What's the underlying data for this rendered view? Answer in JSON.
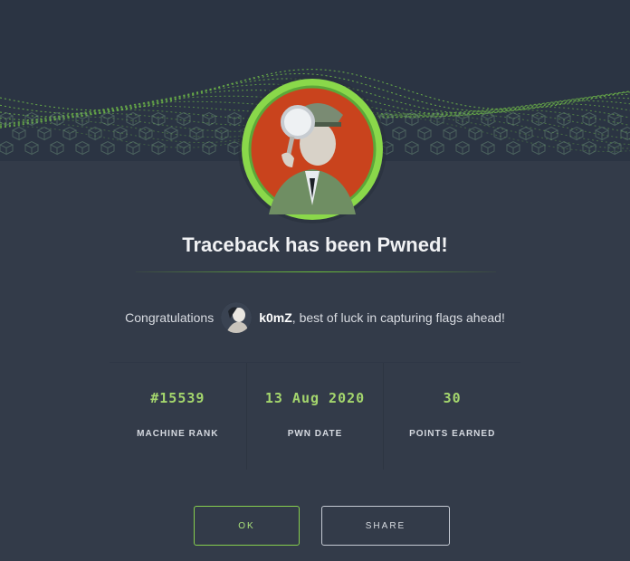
{
  "modal": {
    "title": "Traceback has been Pwned!",
    "congrats_prefix": "Congratulations",
    "username": "k0mZ",
    "congrats_suffix": ", best of luck in capturing flags ahead!"
  },
  "stats": [
    {
      "value": "#15539",
      "label": "MACHINE RANK"
    },
    {
      "value": "13 Aug 2020",
      "label": "PWN DATE"
    },
    {
      "value": "30",
      "label": "POINTS EARNED"
    }
  ],
  "buttons": {
    "ok_label": "OK",
    "share_label": "SHARE"
  },
  "colors": {
    "background": "#333b49",
    "accent": "#9fef00",
    "stat_value": "#a4d66d"
  },
  "icons": {
    "machine_avatar": "detective-with-magnifying-glass-icon",
    "user_avatar": "user-avatar-icon",
    "banner": "green-wave-grid-banner"
  }
}
